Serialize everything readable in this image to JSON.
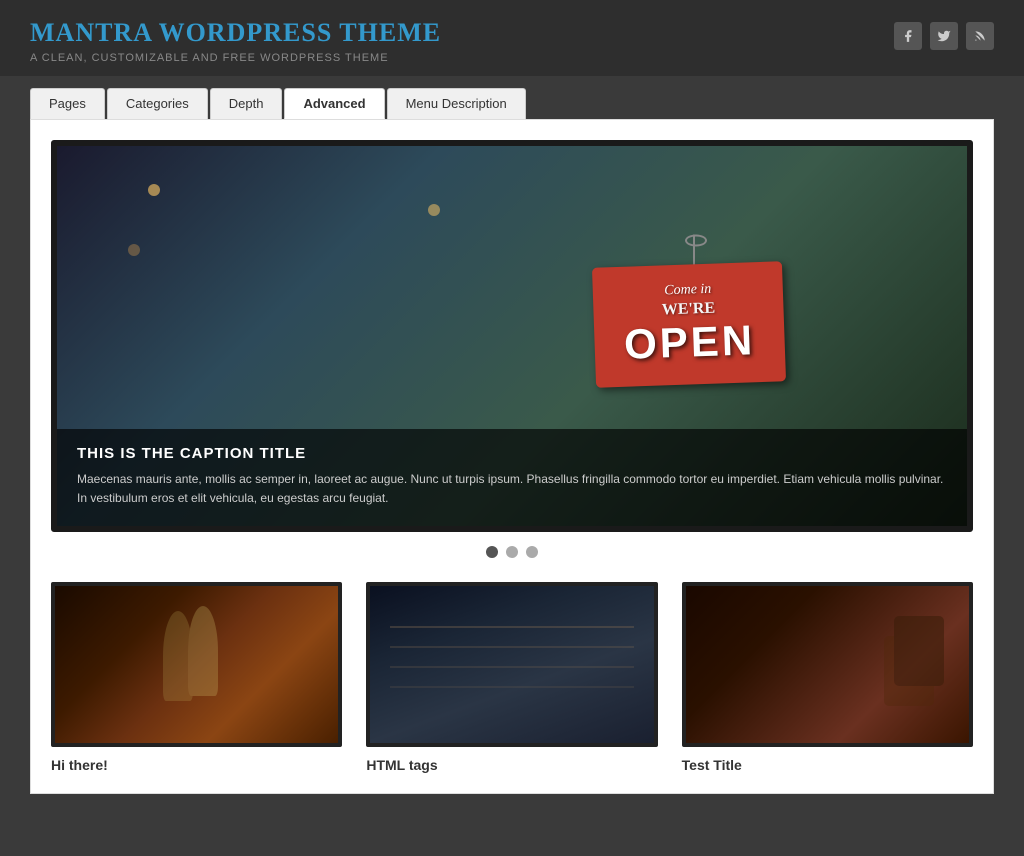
{
  "header": {
    "site_title": "Mantra WordPress Theme",
    "site_tagline": "A Clean, Customizable and Free WordPress Theme"
  },
  "social": {
    "facebook_label": "f",
    "twitter_label": "t",
    "rss_label": "rss"
  },
  "nav": {
    "tabs": [
      {
        "label": "Pages",
        "active": false
      },
      {
        "label": "Categories",
        "active": false
      },
      {
        "label": "Depth",
        "active": false
      },
      {
        "label": "Advanced",
        "active": true
      },
      {
        "label": "Menu Description",
        "active": false
      }
    ]
  },
  "hero": {
    "caption_title": "This is the Caption Title",
    "caption_text": "Maecenas mauris ante, mollis ac semper in, laoreet ac augue. Nunc ut turpis ipsum. Phasellus fringilla commodo tortor eu imperdiet. Etiam vehicula mollis pulvinar. In vestibulum eros et elit vehicula, eu egestas arcu feugiat.",
    "dots": [
      {
        "active": true
      },
      {
        "active": false
      },
      {
        "active": false
      }
    ]
  },
  "posts": [
    {
      "title": "Hi there!"
    },
    {
      "title": "HTML tags"
    },
    {
      "title": "Test Title"
    }
  ]
}
